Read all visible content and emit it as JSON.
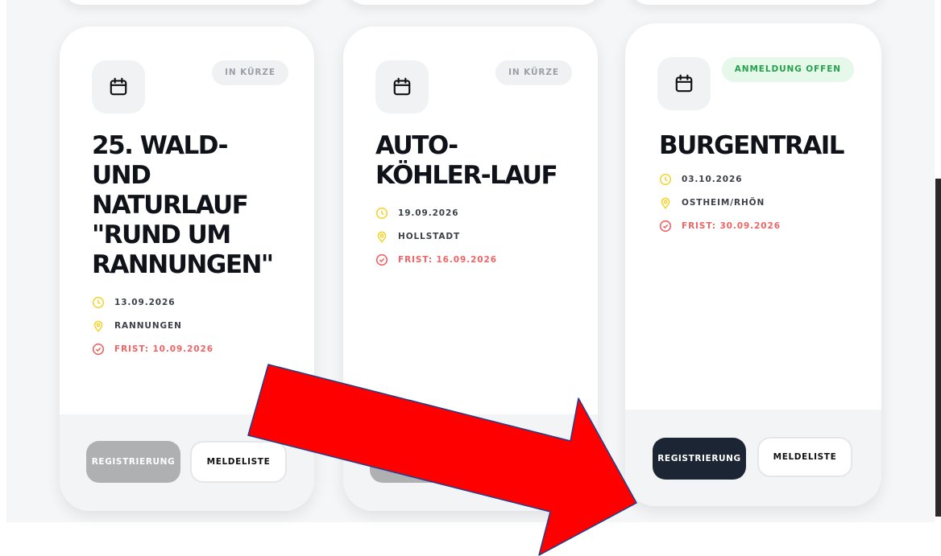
{
  "events": [
    {
      "badge": "IN KÜRZE",
      "title_lines": [
        "25. WALD-",
        "UND",
        "NATURLAUF",
        "\"RUND UM",
        "RANNUNGEN\""
      ],
      "date": "13.09.2026",
      "place": "RANNUNGEN",
      "deadline": "FRIST: 10.09.2026",
      "register_label": "REGISTRIERUNG",
      "register_state": "disabled",
      "list_label": "MELDELISTE"
    },
    {
      "badge": "IN KÜRZE",
      "title_lines": [
        "AUTO-",
        "KÖHLER-LAUF"
      ],
      "date": "19.09.2026",
      "place": "HOLLSTADT",
      "deadline": "FRIST: 16.09.2026",
      "register_state": "disabled"
    },
    {
      "badge": "ANMELDUNG OFFEN",
      "title_lines": [
        "BURGENTRAIL"
      ],
      "date": "03.10.2026",
      "place": "OSTHEIM/RHÖN",
      "deadline": "FRIST: 30.09.2026",
      "register_label": "REGISTRIERUNG",
      "register_state": "active",
      "list_label": "MELDELISTE"
    }
  ],
  "colors": {
    "accent_yellow": "#f2d535",
    "deadline_red": "#ef6464",
    "open_badge_green": "#25a14b",
    "register_active_bg": "#1c2533",
    "register_disabled_bg": "#aeb0b2",
    "annotation_arrow": "#ff0000"
  },
  "icons": {
    "calendar": "calendar-icon",
    "date": "clock-icon",
    "place": "location-pin-icon",
    "deadline": "check-circle-icon"
  },
  "annotation": {
    "type": "arrow",
    "points_to": "registration button of BURGENTRAIL"
  }
}
